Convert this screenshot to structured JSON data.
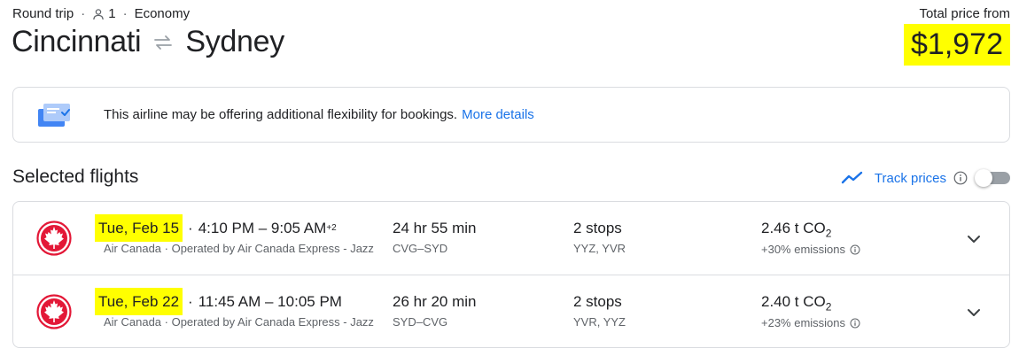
{
  "header": {
    "trip_type": "Round trip",
    "passengers": "1",
    "cabin": "Economy",
    "origin": "Cincinnati",
    "destination": "Sydney",
    "price_label": "Total price from",
    "price": "$1,972"
  },
  "notice": {
    "text": "This airline may be offering additional flexibility for bookings.",
    "link": "More details"
  },
  "section": {
    "title": "Selected flights",
    "track_label": "Track prices"
  },
  "flights": [
    {
      "date": "Tue, Feb 15",
      "times": "4:10 PM – 9:05 AM",
      "day_offset": "+2",
      "carrier": "Air Canada · Operated by Air Canada Express - Jazz",
      "duration": "24 hr 55 min",
      "airports": "CVG–SYD",
      "stops": "2 stops",
      "stop_codes": "YYZ, YVR",
      "co2": "2.46 t CO",
      "co2_sub": "2",
      "emissions": "+30% emissions"
    },
    {
      "date": "Tue, Feb 22",
      "times": "11:45 AM – 10:05 PM",
      "day_offset": "",
      "carrier": "Air Canada · Operated by Air Canada Express - Jazz",
      "duration": "26 hr 20 min",
      "airports": "SYD–CVG",
      "stops": "2 stops",
      "stop_codes": "YVR, YYZ",
      "co2": "2.40 t CO",
      "co2_sub": "2",
      "emissions": "+23% emissions"
    }
  ],
  "colors": {
    "highlight": "#ffff00",
    "link": "#1a73e8",
    "air_canada_red": "#e31837"
  },
  "icons": [
    "person-icon",
    "swap-arrows-icon",
    "ticket-card-icon",
    "trend-line-icon",
    "info-icon",
    "air-canada-logo",
    "chevron-down-icon"
  ]
}
